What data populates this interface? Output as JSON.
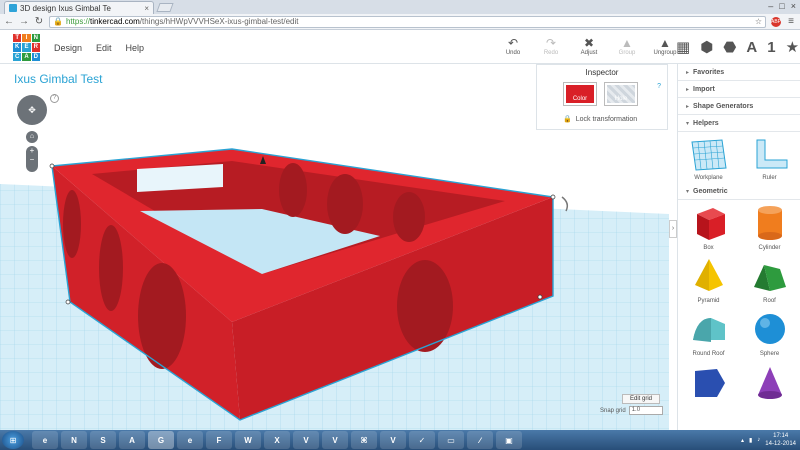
{
  "browser": {
    "tab_title": "3D design Ixus Gimbal Te",
    "url_scheme": "https://",
    "url_host": "tinkercad.com",
    "url_path": "/things/hHWpVVVHSeX-ixus-gimbal-test/edit",
    "ext_label": "ABP"
  },
  "menu": [
    "Design",
    "Edit",
    "Help"
  ],
  "tools": [
    {
      "label": "Undo",
      "icon": "↶",
      "enabled": true
    },
    {
      "label": "Redo",
      "icon": "↷",
      "enabled": false
    },
    {
      "label": "Adjust",
      "icon": "✖",
      "enabled": true
    },
    {
      "label": "Group",
      "icon": "▲",
      "enabled": false
    },
    {
      "label": "Ungroup",
      "icon": "▲",
      "enabled": true
    }
  ],
  "views": [
    "A",
    "1",
    "★"
  ],
  "design_title": "Ixus Gimbal Test",
  "inspector": {
    "title": "Inspector",
    "color_label": "Color",
    "hole_label": "Hole",
    "lock_label": "Lock transformation",
    "help": "?"
  },
  "grid": {
    "edit_label": "Edit grid",
    "snap_label": "Snap grid",
    "snap_value": "1.0"
  },
  "sidebar": {
    "sections": [
      "Favorites",
      "Import",
      "Shape Generators",
      "Helpers"
    ],
    "helpers": [
      {
        "label": "Workplane"
      },
      {
        "label": "Ruler"
      }
    ],
    "geometric_title": "Geometric",
    "shapes": [
      {
        "label": "Box",
        "color": "#d91f27"
      },
      {
        "label": "Cylinder",
        "color": "#f07d1e"
      },
      {
        "label": "Pyramid",
        "color": "#f5c400"
      },
      {
        "label": "Roof",
        "color": "#2e9b3e"
      },
      {
        "label": "Round Roof",
        "color": "#5fc3c8"
      },
      {
        "label": "Sphere",
        "color": "#1e8fd6"
      },
      {
        "label": "",
        "color": "#2a4fb0"
      },
      {
        "label": "",
        "color": "#8d3fb8"
      }
    ]
  },
  "taskbar": {
    "tasks": [
      "e",
      "N",
      "S",
      "A",
      "G",
      "e",
      "F",
      "W",
      "X",
      "V",
      "V",
      "⌘",
      "V",
      "✓",
      "▭",
      "∕",
      "▣"
    ],
    "clock_time": "17:14",
    "clock_date": "14-12-2014"
  }
}
